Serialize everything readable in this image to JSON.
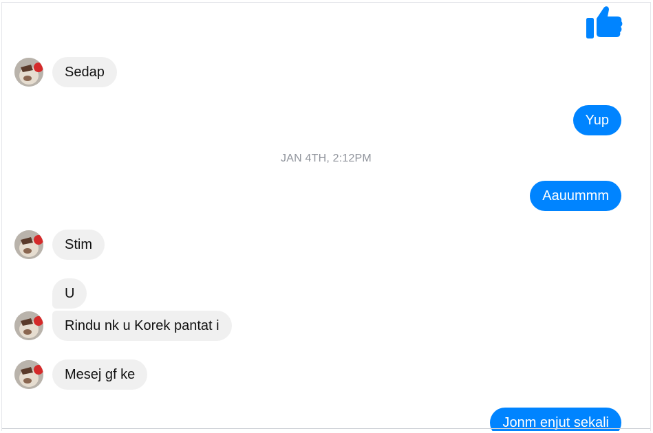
{
  "conversation": {
    "timestamp": "JAN 4TH, 2:12PM",
    "messages": [
      {
        "from": "them",
        "text": "Sedap"
      },
      {
        "from": "me",
        "text": "Yup"
      },
      {
        "from": "me",
        "text": "Aauummm"
      },
      {
        "from": "them",
        "text": "Stim"
      },
      {
        "from": "them",
        "text": "U"
      },
      {
        "from": "them",
        "text": "Rindu nk u Korek pantat i"
      },
      {
        "from": "them",
        "text": "Mesej gf ke"
      },
      {
        "from": "me",
        "text": "Jonm enjut sekali"
      }
    ]
  },
  "colors": {
    "outgoing_bubble": "#0084ff",
    "incoming_bubble": "#f0f0f0",
    "timestamp_text": "#90949c",
    "like_icon": "#0084ff"
  },
  "icons": {
    "like": "thumbs-up-icon",
    "avatar": "contact-avatar"
  }
}
